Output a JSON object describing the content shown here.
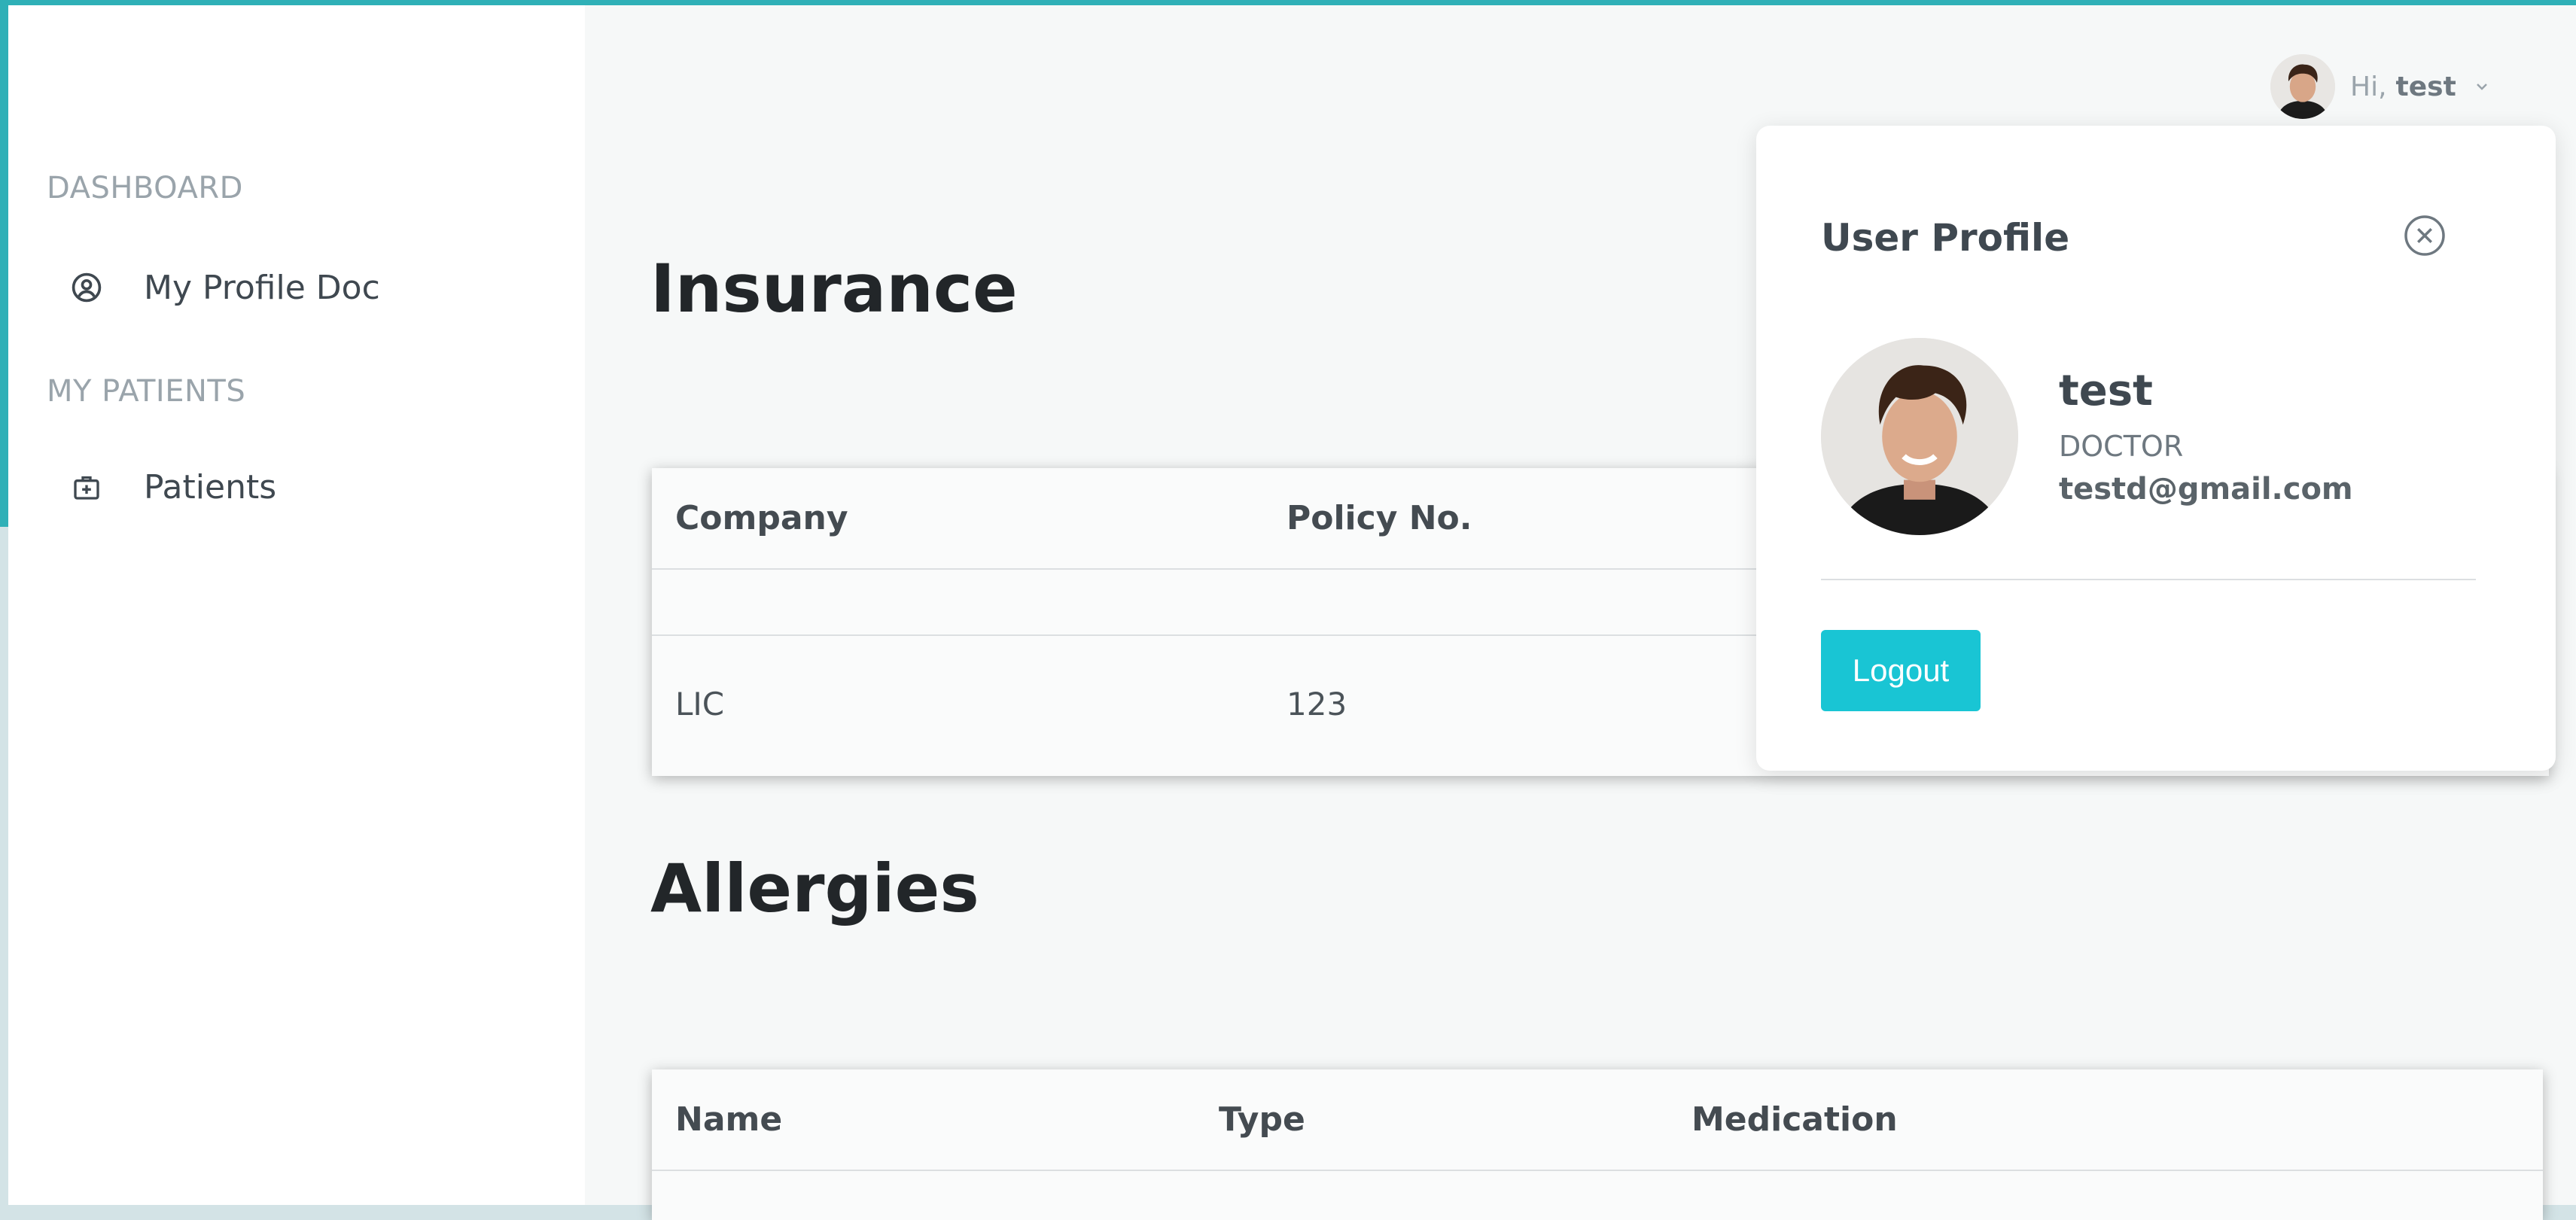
{
  "sidebar": {
    "sections": [
      {
        "title": "DASHBOARD",
        "items": [
          {
            "label": "My Profile Doc",
            "icon": "user-circle-icon"
          }
        ]
      },
      {
        "title": "MY PATIENTS",
        "items": [
          {
            "label": "Patients",
            "icon": "medical-bag-icon"
          }
        ]
      }
    ]
  },
  "header": {
    "greeting": "Hi,",
    "username": "test"
  },
  "insurance": {
    "title": "Insurance",
    "columns": [
      "Company",
      "Policy No."
    ],
    "rows": [
      {
        "company": "LIC",
        "policy_no": "123"
      }
    ]
  },
  "allergies": {
    "title": "Allergies",
    "columns": [
      "Name",
      "Type",
      "Medication"
    ]
  },
  "profile_panel": {
    "title": "User Profile",
    "name": "test",
    "role": "DOCTOR",
    "email": "testd@gmail.com",
    "logout_label": "Logout"
  },
  "colors": {
    "accent": "#19c5d4",
    "frame": "#2fb0b7"
  }
}
